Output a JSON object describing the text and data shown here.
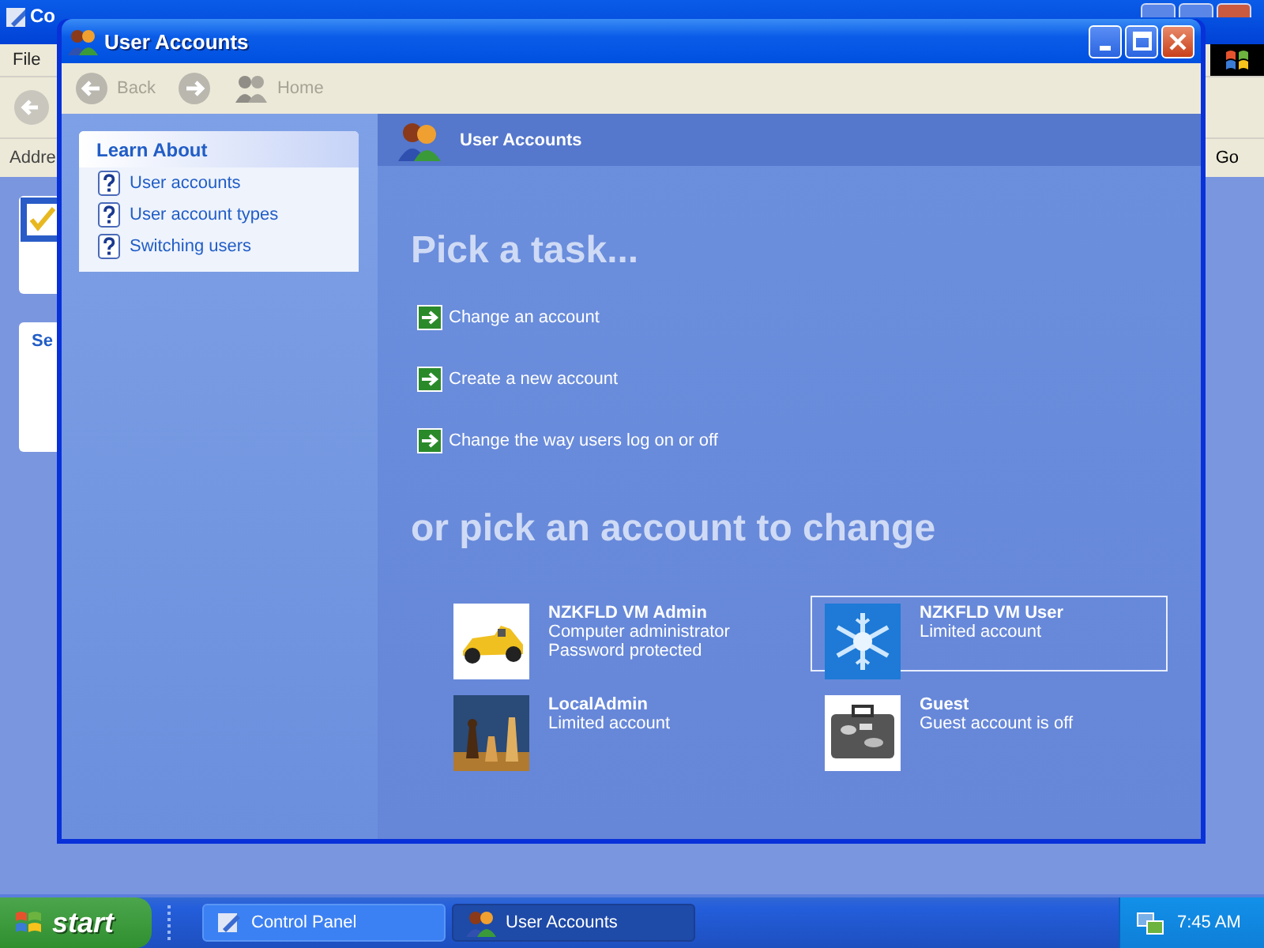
{
  "background_window": {
    "title": "Co",
    "menu": [
      "File"
    ],
    "address_label": "Addre",
    "go_button": "Go",
    "pane_title": "Se"
  },
  "window": {
    "title": "User Accounts"
  },
  "toolbar": [
    {
      "kind": "back",
      "label": "Back",
      "disabled": true
    },
    {
      "kind": "forward",
      "disabled": true
    },
    {
      "kind": "home",
      "label": "Home",
      "disabled": true
    }
  ],
  "learn_about": {
    "title": "Learn About",
    "items": [
      "User accounts",
      "User account types",
      "Switching users"
    ]
  },
  "header": {
    "title": "User Accounts"
  },
  "tasks_heading": "Pick a task...",
  "tasks": [
    "Change an account",
    "Create a new account",
    "Change the way users log on or off"
  ],
  "accounts_heading": "or pick an account to change",
  "accounts": [
    {
      "name": "NZKFLD VM Admin",
      "details": [
        "Computer administrator",
        "Password protected"
      ],
      "selected": false,
      "kind": "picture"
    },
    {
      "name": "NZKFLD VM User",
      "details": [
        "Limited account"
      ],
      "selected": true,
      "kind": "picture"
    },
    {
      "name": "LocalAdmin",
      "details": [
        "Limited account"
      ],
      "selected": false,
      "kind": "picture"
    },
    {
      "name": "Guest",
      "details": [
        "Guest account is off"
      ],
      "selected": false,
      "kind": "picture"
    }
  ],
  "taskbar": {
    "start": "start",
    "tasks": [
      {
        "label": "Control Panel",
        "selected": false
      },
      {
        "label": "User Accounts",
        "selected": true
      }
    ],
    "clock": "7:45 AM"
  }
}
